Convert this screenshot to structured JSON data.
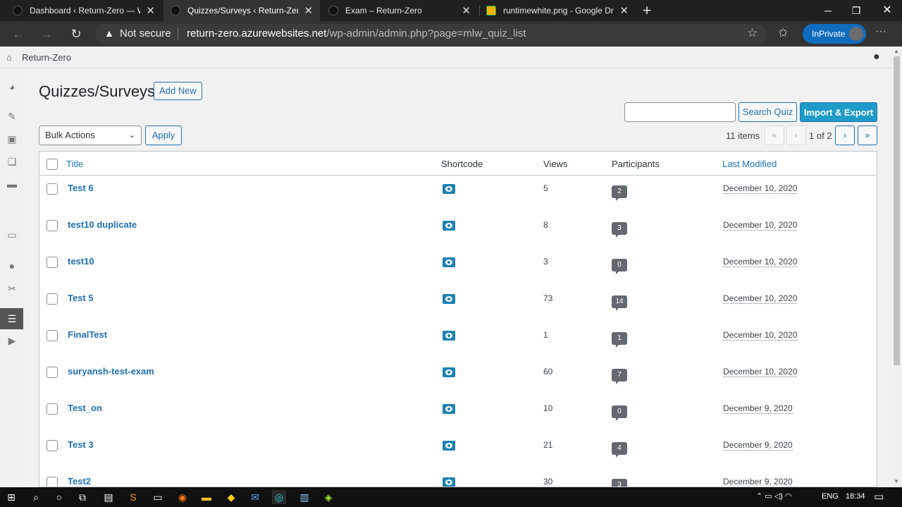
{
  "browser": {
    "tabs": [
      {
        "title": "Dashboard ‹ Return-Zero — Wor",
        "active": false
      },
      {
        "title": "Quizzes/Surveys ‹ Return-Zero –",
        "active": true
      },
      {
        "title": "Exam – Return-Zero",
        "active": false
      },
      {
        "title": "runtimewhite.png - Google Drive",
        "active": false
      }
    ],
    "security_label": "Not secure",
    "url_host": "return-zero.azurewebsites.net",
    "url_path": "/wp-admin/admin.php?page=mlw_quiz_list",
    "inprivate_label": "InPrivate"
  },
  "adminbar": {
    "site_name": "Return-Zero"
  },
  "page": {
    "title": "Quizzes/Surveys",
    "add_new": "Add New",
    "search_button": "Search Quiz",
    "import_export": "Import & Export",
    "bulk_actions": "Bulk Actions",
    "apply": "Apply",
    "item_count": "11 items",
    "page_current": "1",
    "page_of": "of 2",
    "pager": {
      "first": "«",
      "prev": "‹",
      "next": "›",
      "last": "»"
    }
  },
  "table": {
    "headers": {
      "title": "Title",
      "shortcode": "Shortcode",
      "views": "Views",
      "participants": "Participants",
      "last_modified": "Last Modified"
    },
    "rows": [
      {
        "title": "Test 6",
        "views": "5",
        "participants": "2",
        "date": "December 10, 2020"
      },
      {
        "title": "test10 duplicate",
        "views": "8",
        "participants": "3",
        "date": "December 10, 2020"
      },
      {
        "title": "test10",
        "views": "3",
        "participants": "0",
        "date": "December 10, 2020"
      },
      {
        "title": "Test 5",
        "views": "73",
        "participants": "14",
        "date": "December 10, 2020"
      },
      {
        "title": "FinalTest",
        "views": "1",
        "participants": "1",
        "date": "December 10, 2020"
      },
      {
        "title": "suryansh-test-exam",
        "views": "60",
        "participants": "7",
        "date": "December 10, 2020"
      },
      {
        "title": "Test_on",
        "views": "10",
        "participants": "0",
        "date": "December 9, 2020"
      },
      {
        "title": "Test 3",
        "views": "21",
        "participants": "4",
        "date": "December 9, 2020"
      },
      {
        "title": "Test2",
        "views": "30",
        "participants": "3",
        "date": "December 9, 2020"
      }
    ]
  },
  "taskbar": {
    "language": "ENG",
    "time": "18:34"
  }
}
